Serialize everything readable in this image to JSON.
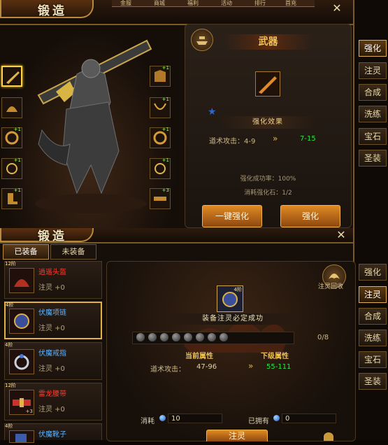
{
  "panel1": {
    "title": "锻造",
    "top_tabs": [
      "金服",
      "商城",
      "福利",
      "活动",
      "排行",
      "首充"
    ],
    "side_tabs": [
      "强化",
      "注灵",
      "合成",
      "洗练",
      "宝石",
      "圣装"
    ],
    "active_side_tab": "强化",
    "slot_levels_left": [
      "",
      "",
      "+1",
      "+1",
      "+1",
      ""
    ],
    "slot_levels_right": [
      "+1",
      "+1",
      "+1",
      "+1",
      "+1",
      "+3"
    ],
    "weapon_heading": "武器",
    "strengthen_result_label": "强化效果",
    "stat_name": "道术攻击：4-9",
    "stat_next": "7-15",
    "success_rate": "强化成功率：100%",
    "stone_cost": "消耗强化石：1/2",
    "btn_one_click": "一键强化",
    "btn_strengthen": "强化"
  },
  "panel2": {
    "title": "锻造",
    "equipped_tab": "已装备",
    "unequipped_tab": "未装备",
    "side_tabs": [
      "强化",
      "注灵",
      "合成",
      "洗练",
      "宝石",
      "圣装"
    ],
    "active_side_tab": "注灵",
    "items": [
      {
        "name": "逍遥头盔",
        "badge": "12阶",
        "infuse": "注灵 +0",
        "name_color": "#ff3b2f"
      },
      {
        "name": "伏魔项链",
        "badge": "4阶",
        "infuse": "注灵 +0",
        "name_color": "#5fb3ff"
      },
      {
        "name": "伏魔戒指",
        "badge": "4阶",
        "infuse": "注灵 +0",
        "name_color": "#5fb3ff"
      },
      {
        "name": "雷龙腰带",
        "badge": "12阶",
        "infuse": "注灵 +0",
        "name_color": "#ff3b2f"
      },
      {
        "name": "伏魔靴子",
        "badge": "4阶",
        "infuse": "",
        "name_color": "#5fb3ff"
      }
    ],
    "item_extra_plus": "+3",
    "recycle_label": "注灵回收",
    "center_badge": "4阶",
    "guarantee_text": "装备注灵必定成功",
    "progress": "0/8",
    "progress_filled": 0,
    "current_attr_label": "当前属性",
    "next_attr_label": "下级属性",
    "stat_name": "道术攻击：",
    "stat_current": "47-96",
    "stat_next": "55-111",
    "cost_label": "消耗",
    "cost_value": "10",
    "own_label": "已拥有",
    "own_value": "0",
    "btn_infuse": "注灵"
  },
  "colors": {
    "gold": "#e0b054",
    "green": "#33e24a",
    "blue": "#5fb3ff",
    "red": "#ff3b2f"
  }
}
